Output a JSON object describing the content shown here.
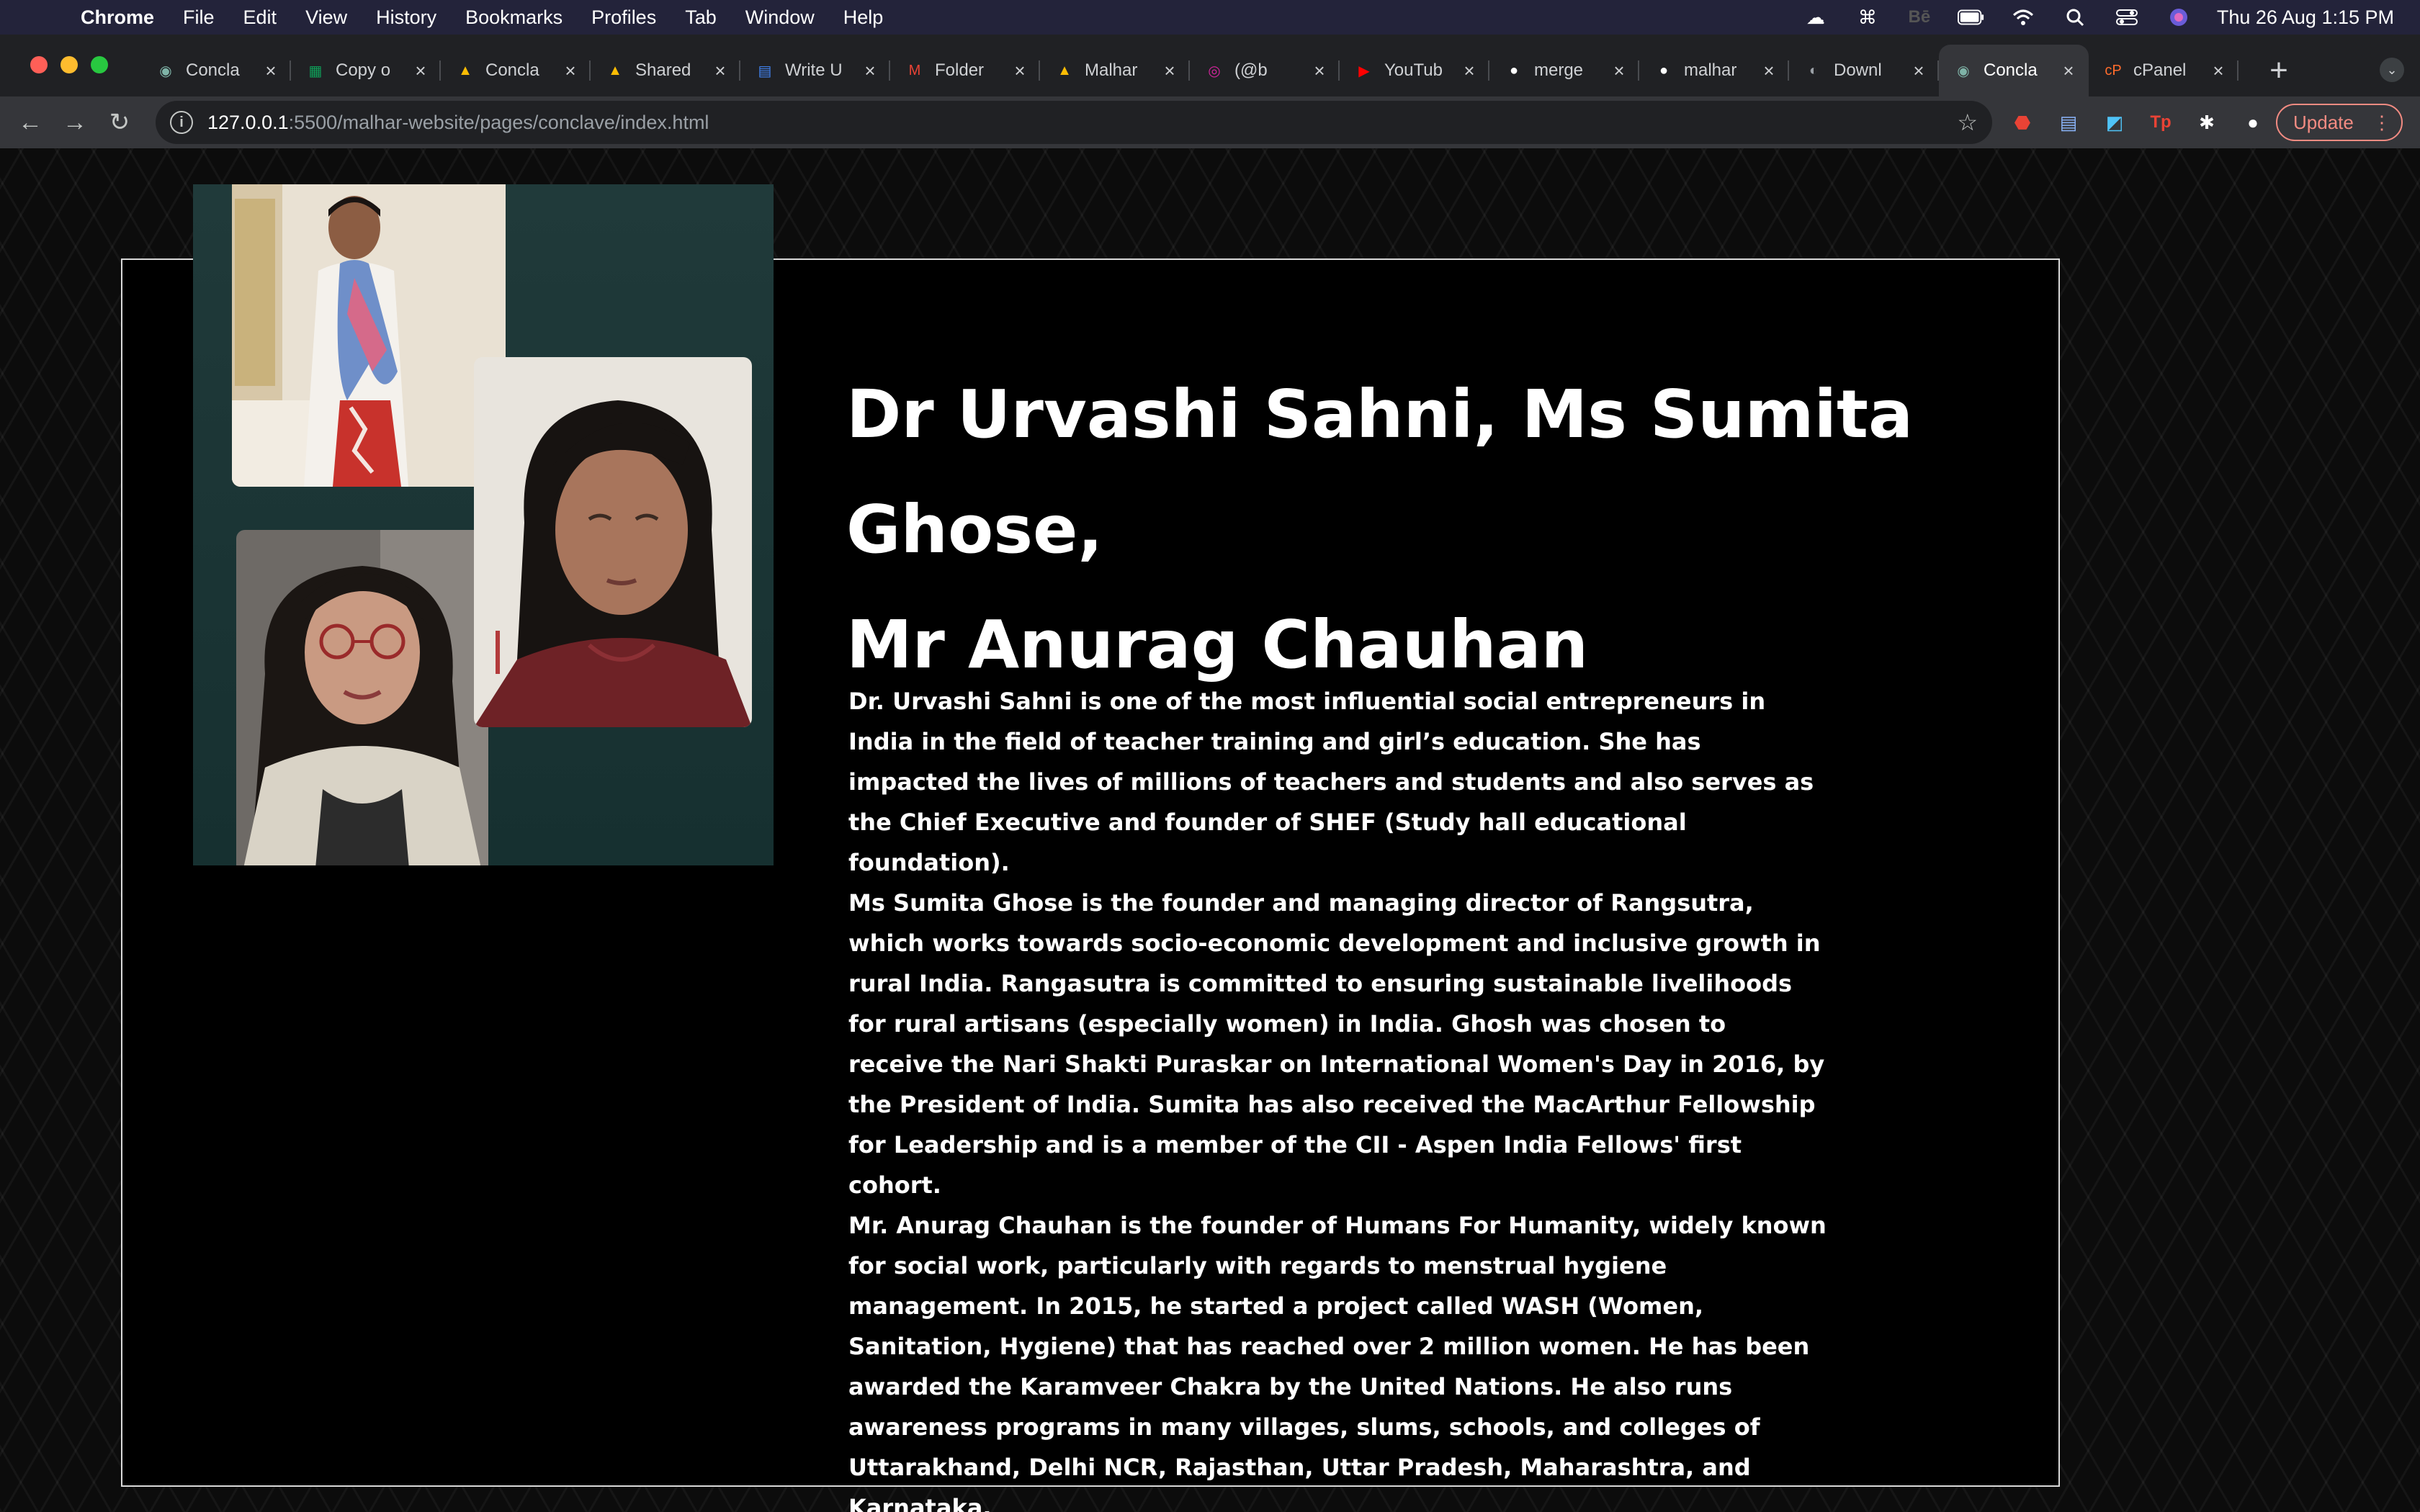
{
  "menubar": {
    "app": "Chrome",
    "items": [
      "File",
      "Edit",
      "View",
      "History",
      "Bookmarks",
      "Profiles",
      "Tab",
      "Window",
      "Help"
    ],
    "clock": "Thu 26 Aug  1:15 PM"
  },
  "tabs": [
    {
      "label": "Concla",
      "icon": "eye-icon",
      "color": "#7fb3a7"
    },
    {
      "label": "Copy o",
      "icon": "sheets-icon",
      "color": "#0f9d58"
    },
    {
      "label": "Concla",
      "icon": "drive-icon",
      "color": "#fbbc04"
    },
    {
      "label": "Shared",
      "icon": "drive-icon",
      "color": "#fbbc04"
    },
    {
      "label": "Write U",
      "icon": "docs-icon",
      "color": "#4285f4"
    },
    {
      "label": "Folder",
      "icon": "gmail-icon",
      "color": "#ea4335"
    },
    {
      "label": "Malhar",
      "icon": "drive-icon",
      "color": "#fbbc04"
    },
    {
      "label": "(@b",
      "icon": "instagram-icon",
      "color": "#d6249f"
    },
    {
      "label": "YouTub",
      "icon": "youtube-icon",
      "color": "#ff0000"
    },
    {
      "label": "merge",
      "icon": "github-icon",
      "color": "#ffffff"
    },
    {
      "label": "malhar",
      "icon": "github-icon",
      "color": "#ffffff"
    },
    {
      "label": "Downl",
      "icon": "globe-icon",
      "color": "#9aa0a6"
    },
    {
      "label": "Concla",
      "icon": "eye-icon",
      "color": "#7fb3a7",
      "active": true
    },
    {
      "label": "cPanel",
      "icon": "cpanel-icon",
      "color": "#ff6c2c"
    }
  ],
  "address": {
    "host": "127.0.0.1",
    "path": ":5500/malhar-website/pages/conclave/index.html"
  },
  "update_label": "Update",
  "page": {
    "title_line1": "Dr Urvashi Sahni, Ms Sumita Ghose,",
    "title_line2": "Mr Anurag Chauhan",
    "bio": [
      "Dr. Urvashi Sahni is one of the most influential social entrepreneurs in India in the field of teacher training and girl’s education. She has impacted the lives of millions of teachers and students and also serves as the Chief Executive and founder of SHEF (Study hall educational foundation).",
      "Ms Sumita Ghose is the founder and managing director of Rangsutra, which works towards socio-economic development and inclusive growth in rural India. Rangasutra is committed to ensuring sustainable livelihoods for rural artisans (especially women) in India. Ghosh was chosen to receive the Nari Shakti Puraskar on International Women's Day in 2016, by the President of India. Sumita has also received the MacArthur Fellowship for Leadership and is a member of the CII - Aspen India Fellows' first cohort.",
      "Mr. Anurag Chauhan is the founder of Humans For Humanity, widely known for social work, particularly with regards to menstrual hygiene management. In 2015, he started a project called WASH (Women, Sanitation, Hygiene) that has reached over 2 million women. He has been awarded the Karamveer Chakra by the United Nations. He also runs awareness programs in many villages, slums, schools, and colleges of Uttarakhand, Delhi NCR, Rajasthan, Uttar Pradesh, Maharashtra, and Karnataka."
    ]
  }
}
